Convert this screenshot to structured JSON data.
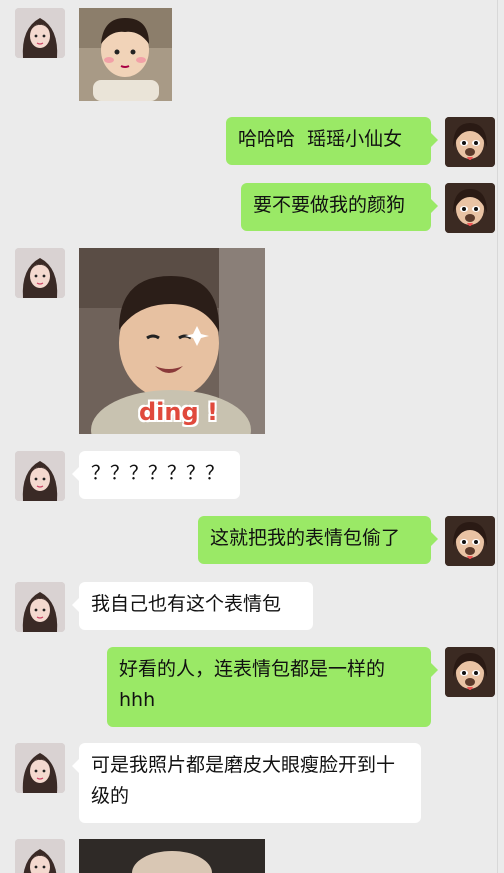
{
  "chat": {
    "messages": [
      {
        "side": "left",
        "type": "image",
        "description": "toddler-photo-sticker"
      },
      {
        "side": "right",
        "type": "text",
        "text": "哈哈哈  瑶瑶小仙女"
      },
      {
        "side": "right",
        "type": "text",
        "text": "要不要做我的颜狗"
      },
      {
        "side": "left",
        "type": "image",
        "caption": "ding !"
      },
      {
        "side": "left",
        "type": "text",
        "text": "？？？？？？？"
      },
      {
        "side": "right",
        "type": "text",
        "text": "这就把我的表情包偷了"
      },
      {
        "side": "left",
        "type": "text",
        "text": "我自己也有这个表情包"
      },
      {
        "side": "right",
        "type": "text",
        "text": "好看的人，连表情包都是一样的hhh"
      },
      {
        "side": "left",
        "type": "text",
        "text": "可是我照片都是磨皮大眼瘦脸开到十级的"
      },
      {
        "side": "left",
        "type": "image",
        "description": "partial-photo"
      }
    ]
  },
  "colors": {
    "background": "#ebebeb",
    "self_bubble": "#9ae966",
    "other_bubble": "#ffffff",
    "sticker_text": "#e0493c"
  }
}
